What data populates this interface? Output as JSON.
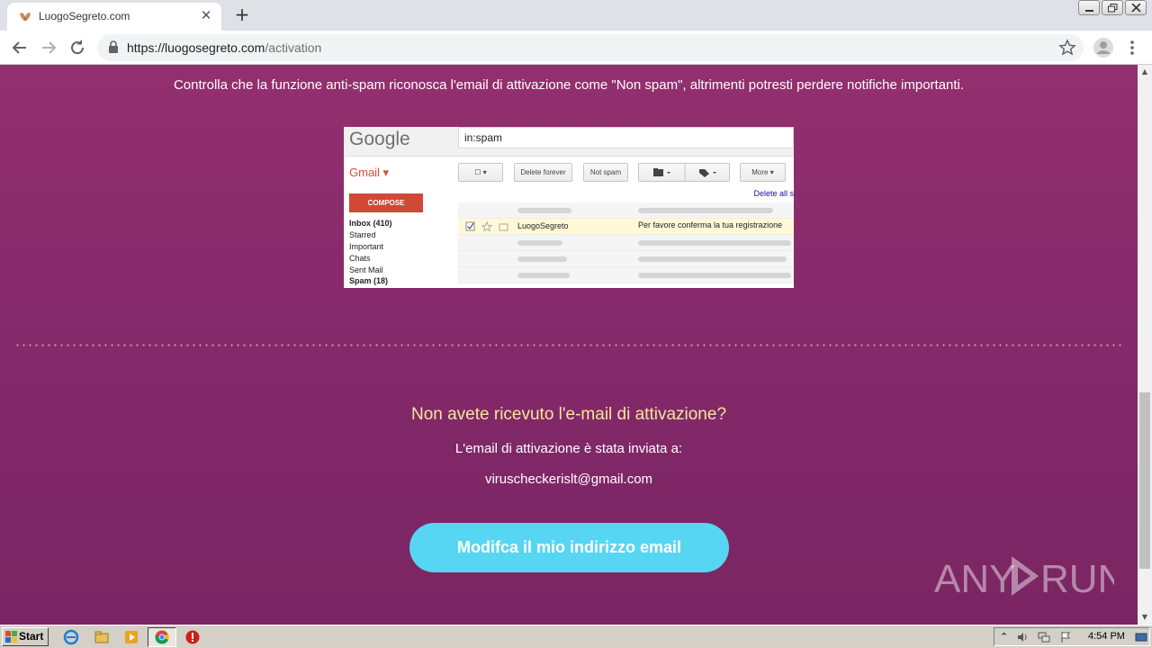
{
  "browser": {
    "tab_title": "LuogoSegreto.com",
    "url_host": "https://luogosegreto.com",
    "url_path": "/activation"
  },
  "page": {
    "spam_note": "Controlla che la funzione anti-spam riconosca l'email di attivazione come \"Non spam\", altrimenti potresti perdere notifiche importanti.",
    "question": "Non avete ricevuto l'e-mail di attivazione?",
    "sent_to": "L'email di attivazione è stata inviata a:",
    "email": "viruscheckerislt@gmail.com",
    "cta_label": "Modifca il mio indirizzo email",
    "watermark": "ANY RUN"
  },
  "gmail_image": {
    "logo": "Google",
    "search": "in:spam",
    "gmail_label": "Gmail ▾",
    "buttons": [
      "Delete forever",
      "Not spam",
      "More ▾"
    ],
    "delete_all": "Delete all s",
    "compose": "COMPOSE",
    "sidebar": [
      "Inbox (410)",
      "Starred",
      "Important",
      "Chats",
      "Sent Mail",
      "Spam (18)"
    ],
    "highlight_from": "LuogoSegreto",
    "highlight_subject": "Per favore conferma la tua registrazione"
  },
  "taskbar": {
    "start_label": "Start",
    "clock": "4:54 PM"
  },
  "colors": {
    "page_bg": "#862a6b",
    "question_text": "#f5e59a",
    "cta_bg": "#56d6f2"
  }
}
